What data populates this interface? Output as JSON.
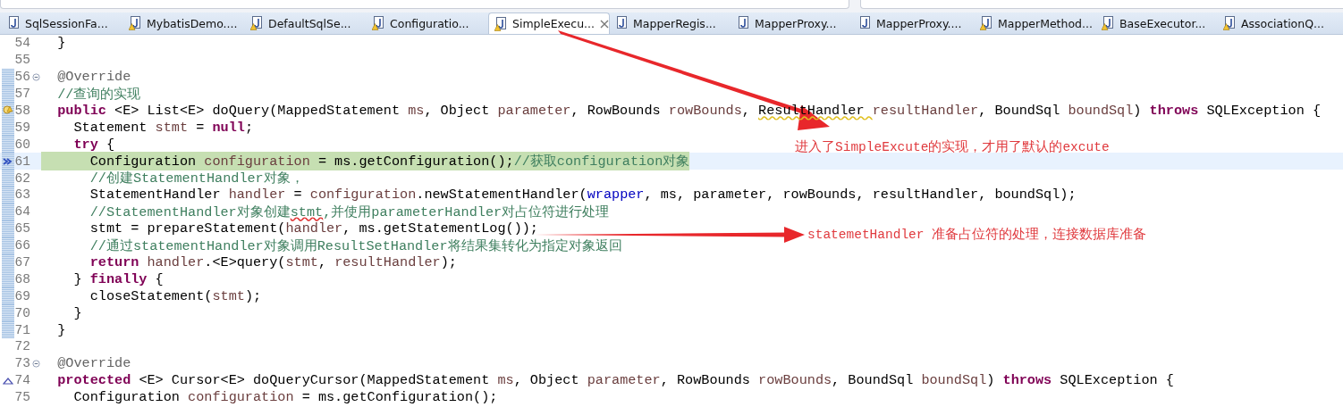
{
  "tabs": [
    {
      "label": "SqlSessionFa...",
      "selected": false,
      "warning": false
    },
    {
      "label": "MybatisDemo....",
      "selected": false,
      "warning": true
    },
    {
      "label": "DefaultSqlSe...",
      "selected": false,
      "warning": true
    },
    {
      "label": "Configuratio...",
      "selected": false,
      "warning": true
    },
    {
      "label": "SimpleExecu...",
      "selected": true,
      "warning": true
    },
    {
      "label": "MapperRegis...",
      "selected": false,
      "warning": false
    },
    {
      "label": "MapperProxy...",
      "selected": false,
      "warning": false
    },
    {
      "label": "MapperProxy....",
      "selected": false,
      "warning": false
    },
    {
      "label": "MapperMethod...",
      "selected": false,
      "warning": true
    },
    {
      "label": "BaseExecutor...",
      "selected": false,
      "warning": true
    },
    {
      "label": "AssociationQ...",
      "selected": false,
      "warning": true
    }
  ],
  "lines": [
    {
      "number": "54",
      "range": false,
      "current": false,
      "tokens": [
        {
          "kind": "plain",
          "text": "  }"
        }
      ]
    },
    {
      "number": "55",
      "range": false,
      "current": false
    },
    {
      "number": "56",
      "range": true,
      "current": false,
      "fold": {
        "expanded": true
      },
      "tokens": [
        {
          "kind": "annotation",
          "text": "  @Override"
        }
      ]
    },
    {
      "number": "57",
      "range": true,
      "current": false,
      "tokens": [
        {
          "kind": "comment",
          "text": "  //查询的实现"
        }
      ]
    },
    {
      "number": "58",
      "range": true,
      "current": false,
      "marker": {
        "kind": "warning"
      },
      "tokens": [
        {
          "kind": "keyword",
          "text": "  public"
        },
        {
          "kind": "plain",
          "text": " <E> List<E> doQuery(MappedStatement "
        },
        {
          "kind": "variable",
          "text": "ms"
        },
        {
          "kind": "plain",
          "text": ", Object "
        },
        {
          "kind": "variable",
          "text": "parameter"
        },
        {
          "kind": "plain",
          "text": ", RowBounds "
        },
        {
          "kind": "variable",
          "text": "rowBounds"
        },
        {
          "kind": "plain",
          "text": ", "
        },
        {
          "kind": "plain",
          "text": "ResultHandler ",
          "warning_underline": true
        },
        {
          "kind": "variable",
          "text": "resultHandler"
        },
        {
          "kind": "plain",
          "text": ", BoundSql "
        },
        {
          "kind": "variable",
          "text": "boundSql"
        },
        {
          "kind": "plain",
          "text": ") "
        },
        {
          "kind": "keyword",
          "text": "throws"
        },
        {
          "kind": "plain",
          "text": " SQLException {"
        }
      ]
    },
    {
      "number": "59",
      "range": true,
      "current": false,
      "tokens": [
        {
          "kind": "plain",
          "text": "    Statement "
        },
        {
          "kind": "variable",
          "text": "stmt"
        },
        {
          "kind": "plain",
          "text": " = "
        },
        {
          "kind": "keyword",
          "text": "null"
        },
        {
          "kind": "plain",
          "text": ";"
        }
      ]
    },
    {
      "number": "60",
      "range": true,
      "current": false,
      "tokens": [
        {
          "kind": "keyword",
          "text": "    try"
        },
        {
          "kind": "plain",
          "text": " {"
        }
      ]
    },
    {
      "number": "61",
      "range": true,
      "current": true,
      "marker": {
        "kind": "debug"
      },
      "tokens": [
        {
          "kind": "plain",
          "text": "      Configuration "
        },
        {
          "kind": "variable",
          "text": "configuration"
        },
        {
          "kind": "plain",
          "text": " = ms.getConfiguration();"
        },
        {
          "kind": "comment",
          "text": "//获取configuration对象"
        }
      ]
    },
    {
      "number": "62",
      "range": true,
      "current": false,
      "tokens": [
        {
          "kind": "comment",
          "text": "      //创建StatementHandler对象，"
        }
      ]
    },
    {
      "number": "63",
      "range": true,
      "current": false,
      "tokens": [
        {
          "kind": "plain",
          "text": "      StatementHandler "
        },
        {
          "kind": "variable",
          "text": "handler"
        },
        {
          "kind": "plain",
          "text": " = "
        },
        {
          "kind": "variable",
          "text": "configuration"
        },
        {
          "kind": "plain",
          "text": ".newStatementHandler("
        },
        {
          "kind": "field",
          "text": "wrapper"
        },
        {
          "kind": "plain",
          "text": ", ms, parameter, rowBounds, resultHandler, boundSql);"
        }
      ]
    },
    {
      "number": "64",
      "range": true,
      "current": false,
      "tokens": [
        {
          "kind": "comment",
          "text": "      //StatementHandler对象创建"
        },
        {
          "kind": "comment",
          "text": "stmt",
          "spelling_underline": true
        },
        {
          "kind": "comment",
          "text": ",并使用parameterHandler对占位符进行处理"
        }
      ]
    },
    {
      "number": "65",
      "range": true,
      "current": false,
      "tokens": [
        {
          "kind": "plain",
          "text": "      stmt = prepareStatement("
        },
        {
          "kind": "variable",
          "text": "handler"
        },
        {
          "kind": "plain",
          "text": ", ms.getStatementLog());"
        }
      ]
    },
    {
      "number": "66",
      "range": true,
      "current": false,
      "tokens": [
        {
          "kind": "comment",
          "text": "      //通过statementHandler对象调用ResultSetHandler将结果集转化为指定对象返回"
        }
      ]
    },
    {
      "number": "67",
      "range": true,
      "current": false,
      "tokens": [
        {
          "kind": "keyword",
          "text": "      return"
        },
        {
          "kind": "variable",
          "text": " handler"
        },
        {
          "kind": "plain",
          "text": ".<E>query("
        },
        {
          "kind": "variable",
          "text": "stmt"
        },
        {
          "kind": "plain",
          "text": ", "
        },
        {
          "kind": "variable",
          "text": "resultHandler"
        },
        {
          "kind": "plain",
          "text": ");"
        }
      ]
    },
    {
      "number": "68",
      "range": true,
      "current": false,
      "tokens": [
        {
          "kind": "plain",
          "text": "    } "
        },
        {
          "kind": "keyword",
          "text": "finally"
        },
        {
          "kind": "plain",
          "text": " {"
        }
      ]
    },
    {
      "number": "69",
      "range": true,
      "current": false,
      "tokens": [
        {
          "kind": "plain",
          "text": "      closeStatement("
        },
        {
          "kind": "variable",
          "text": "stmt"
        },
        {
          "kind": "plain",
          "text": ");"
        }
      ]
    },
    {
      "number": "70",
      "range": true,
      "current": false,
      "tokens": [
        {
          "kind": "plain",
          "text": "    }"
        }
      ]
    },
    {
      "number": "71",
      "range": true,
      "current": false,
      "tokens": [
        {
          "kind": "plain",
          "text": "  }"
        }
      ]
    },
    {
      "number": "72",
      "range": false,
      "current": false
    },
    {
      "number": "73",
      "range": false,
      "current": false,
      "fold": {
        "expanded": true
      },
      "tokens": [
        {
          "kind": "annotation",
          "text": "  @Override"
        }
      ]
    },
    {
      "number": "74",
      "range": false,
      "current": false,
      "marker": {
        "kind": "override"
      },
      "tokens": [
        {
          "kind": "keyword",
          "text": "  protected"
        },
        {
          "kind": "plain",
          "text": " <E> Cursor<E> doQueryCursor(MappedStatement "
        },
        {
          "kind": "variable",
          "text": "ms"
        },
        {
          "kind": "plain",
          "text": ", Object "
        },
        {
          "kind": "variable",
          "text": "parameter"
        },
        {
          "kind": "plain",
          "text": ", RowBounds "
        },
        {
          "kind": "variable",
          "text": "rowBounds"
        },
        {
          "kind": "plain",
          "text": ", BoundSql "
        },
        {
          "kind": "variable",
          "text": "boundSql"
        },
        {
          "kind": "plain",
          "text": ") "
        },
        {
          "kind": "keyword",
          "text": "throws"
        },
        {
          "kind": "plain",
          "text": " SQLException {"
        }
      ]
    },
    {
      "number": "75",
      "range": false,
      "current": false,
      "tokens": [
        {
          "kind": "plain",
          "text": "    Configuration "
        },
        {
          "kind": "variable",
          "text": "configuration"
        },
        {
          "kind": "plain",
          "text": " = ms.getConfiguration();"
        }
      ]
    }
  ],
  "annotations": [
    {
      "text": "进入了SimpleExcute的实现，才用了默认的excute"
    },
    {
      "text": "statemetHandler 准备占位符的处理，连接数据库准备"
    }
  ]
}
